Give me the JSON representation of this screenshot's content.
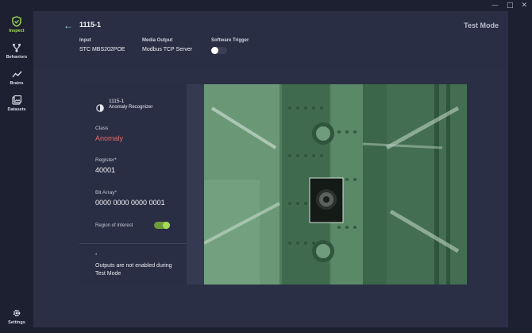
{
  "window": {
    "controls": [
      "—",
      "□",
      "✕"
    ]
  },
  "sidebar": {
    "items": [
      {
        "label": "Inspect",
        "icon": "shield-check-icon",
        "active": true
      },
      {
        "label": "Behaviors",
        "icon": "branch-icon",
        "active": false
      },
      {
        "label": "Brains",
        "icon": "line-chart-icon",
        "active": false
      },
      {
        "label": "Datasets",
        "icon": "image-stack-icon",
        "active": false
      }
    ],
    "settings": {
      "label": "Settings",
      "icon": "gear-icon"
    }
  },
  "header": {
    "back_icon": "back-arrow-icon",
    "title": "1115-1",
    "mode": "Test Mode",
    "fields": {
      "input": {
        "label": "Input",
        "value": "STC MBS202POE"
      },
      "media_output": {
        "label": "Media Output",
        "value": "Modbus TCP Server"
      },
      "software_trigger": {
        "label": "Software Trigger",
        "enabled": false
      }
    }
  },
  "panel": {
    "component_icon": "recognizer-icon",
    "component_name": "1115-1",
    "component_type": "Anomaly Recognizer",
    "class_label": "Class",
    "class_value": "Anomaly",
    "register_label": "Register*",
    "register_value": "40001",
    "bit_array_label": "Bit Array*",
    "bit_array_value": "0000 0000 0000 0001",
    "roi_label": "Region of Interest",
    "roi_enabled": true,
    "note_mark": "*",
    "note_text": "Outputs are not enabled during Test Mode"
  },
  "colors": {
    "accent": "#a6dd5a",
    "anomaly": "#e06a6a",
    "background": "#1d2030",
    "panel": "#2a2e44",
    "image_tint": "#4e7c5c"
  }
}
